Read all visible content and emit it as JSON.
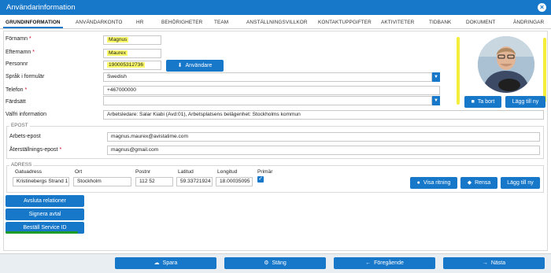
{
  "window": {
    "title": "Användarinformation",
    "close_glyph": "×"
  },
  "tabs": [
    {
      "label": "GRUNDINFORMATION",
      "active": true
    },
    {
      "label": "ANVÄNDARKONTO"
    },
    {
      "label": "HR"
    },
    {
      "label": "BEHÖRIGHETER"
    },
    {
      "label": "TEAM"
    },
    {
      "label": "ANSTÄLLNINGSVILLKOR"
    },
    {
      "label": "KONTAKTUPPGIFTER"
    },
    {
      "label": "AKTIVITETER"
    },
    {
      "label": "TIDBANK"
    },
    {
      "label": "DOKUMENT"
    },
    {
      "label": "ÄNDRINGAR"
    }
  ],
  "basic": {
    "first_name_label": "Förnamn",
    "first_name_value": "Magnus",
    "last_name_label": "Efternamn",
    "last_name_value": "Maurex",
    "personnr_label": "Personnr",
    "personnr_value": "190005312736",
    "user_button": "Användare",
    "language_label": "Språk i formulär",
    "language_value": "Swedish",
    "phone_label": "Telefon",
    "phone_value": "+467000000",
    "fardsatt_label": "Färdsätt",
    "fardsatt_value": "",
    "optional_label": "Valfri information",
    "optional_value": "Arbetsledare: Salar Kiabi (Avd:01), Arbetsplatsens belägenhet: Stockholms kommun",
    "required_mark": "*"
  },
  "photo_buttons": {
    "remove": "Ta bort",
    "add": "Lägg till ny"
  },
  "email": {
    "legend": "EPOST",
    "work_label": "Arbets-epost",
    "work_value": "magnus.maurex@avistatime.com",
    "recovery_label": "Återställnings-epost",
    "recovery_value": "magnus@gmail.com"
  },
  "address": {
    "legend": "ADRESS",
    "columns": [
      "Gatuadress",
      "Ort",
      "Postnr",
      "Latitud",
      "Longitud",
      "Primär"
    ],
    "row": {
      "street": "Kristinebergs Strand 1",
      "city": "Stockholm",
      "postnr": "112 52",
      "lat": "59.33721924",
      "lng": "18.00035095",
      "primary": true
    },
    "check_glyph": "✓",
    "buttons": {
      "map": "Visa ritning",
      "clear": "Rensa",
      "add": "Lägg till ny"
    }
  },
  "actions": {
    "relations": "Avsluta relationer",
    "sign": "Signera avtal",
    "service": "Beställ Service ID"
  },
  "footer": {
    "save": "Spara",
    "close": "Stäng",
    "prev": "Föregående",
    "next": "Nästa"
  },
  "colors": {
    "accent": "#1777c9",
    "highlight": "#fbfb6a",
    "annotation_yellow": "#f4ee3b",
    "annotation_green": "#1e9c2a"
  }
}
